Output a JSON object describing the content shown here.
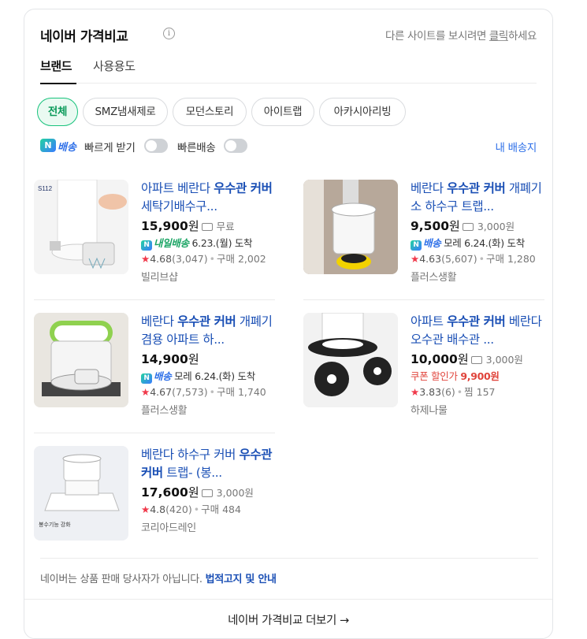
{
  "header": {
    "title": "네이버 가격비교",
    "info_icon": "info-icon",
    "other_site_prefix": "다른 사이트를 보시려면 ",
    "other_site_link": "클릭",
    "other_site_suffix": "하세요"
  },
  "tabs": [
    {
      "label": "브랜드",
      "active": true
    },
    {
      "label": "사용용도",
      "active": false
    }
  ],
  "chips": [
    {
      "label": "전체",
      "active": true
    },
    {
      "label": "SMZ냄새제로",
      "active": false
    },
    {
      "label": "모던스토리",
      "active": false
    },
    {
      "label": "아이트랩",
      "active": false
    },
    {
      "label": "아카시아리빙",
      "active": false
    }
  ],
  "toggles": {
    "badge_letter": "N",
    "badge_text": "배송",
    "fast_label": "빠르게 받기",
    "fast_delivery_label": "빠른배송",
    "my_address": "내 배송지"
  },
  "products": [
    {
      "name_parts": [
        "아파트 베란다 ",
        "우수관 커버",
        " 세탁기배수구..."
      ],
      "price": "15,900",
      "unit": "원",
      "shipping": "무료",
      "delivery_badge": "내일배송",
      "delivery_type": "tomorrow",
      "delivery_date": "6.23.(월) 도착",
      "rating": "4.68",
      "reviews": "(3,047)",
      "purchase": "구매 2,002",
      "seller": "빌리브샵"
    },
    {
      "name_parts": [
        "베란다 ",
        "우수관 커버",
        " 개폐기 소 하수구 트랩..."
      ],
      "price": "9,500",
      "unit": "원",
      "shipping": "3,000원",
      "delivery_badge": "배송",
      "delivery_type": "n",
      "delivery_date": "모레 6.24.(화) 도착",
      "rating": "4.63",
      "reviews": "(5,607)",
      "purchase": "구매 1,280",
      "seller": "플러스생활"
    },
    {
      "name_parts": [
        "베란다 ",
        "우수관 커버",
        " 개폐기 겸용 아파트 하..."
      ],
      "price": "14,900",
      "unit": "원",
      "shipping": "",
      "delivery_badge": "배송",
      "delivery_type": "n",
      "delivery_date": "모레 6.24.(화) 도착",
      "rating": "4.67",
      "reviews": "(7,573)",
      "purchase": "구매 1,740",
      "seller": "플러스생활"
    },
    {
      "name_parts": [
        "아파트 ",
        "우수관 커버",
        " 베란다 오수관 배수관 ..."
      ],
      "price": "10,000",
      "unit": "원",
      "shipping": "3,000원",
      "coupon_label": "쿠폰 할인가",
      "coupon_price": "9,900원",
      "rating": "3.83",
      "reviews": "(6)",
      "purchase": "찜 157",
      "seller": "하제나물"
    },
    {
      "name_parts": [
        "베란다 하수구 커버 ",
        "우수관 커버",
        " 트랩- (봉..."
      ],
      "price": "17,600",
      "unit": "원",
      "shipping": "3,000원",
      "rating": "4.8",
      "reviews": "(420)",
      "purchase": "구매 484",
      "seller": "코리아드레인"
    }
  ],
  "thumb_labels": {
    "p1": "S112",
    "p5": "봉수기능 강화"
  },
  "notice": {
    "text": "네이버는 상품 판매 당사자가 아닙니다. ",
    "link": "법적고지 및 안내"
  },
  "more": "네이버 가격비교 더보기 →"
}
